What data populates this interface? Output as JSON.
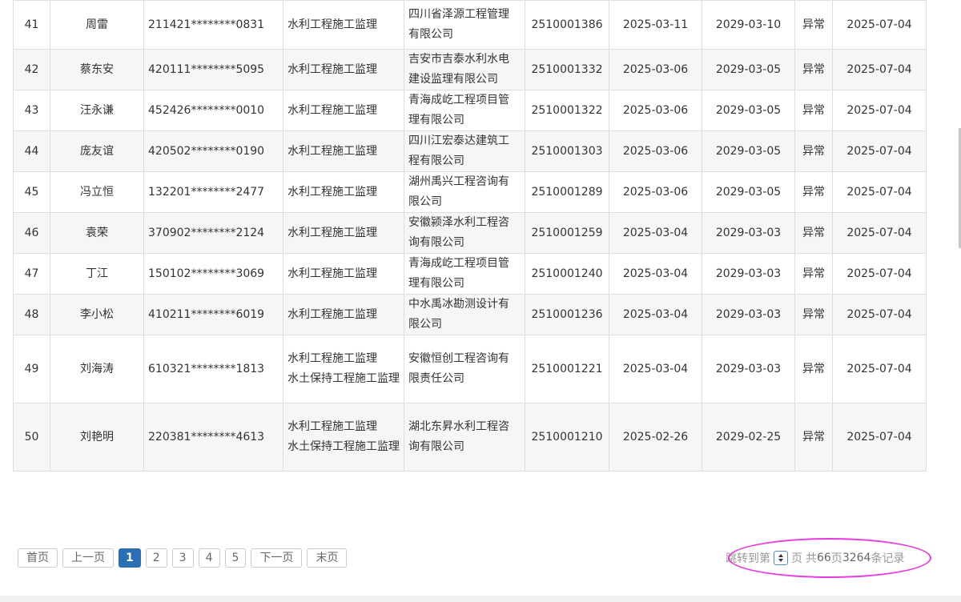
{
  "table": {
    "rows": [
      {
        "no": "41",
        "name": "周雷",
        "id": "211421********0831",
        "major": "水利工程施工监理",
        "company": "四川省泽源工程管理有限公司",
        "cert": "2510001386",
        "reg": "2025-03-11",
        "expire": "2029-03-10",
        "status": "异常",
        "updated": "2025-07-04"
      },
      {
        "no": "42",
        "name": "蔡东安",
        "id": "420111********5095",
        "major": "水利工程施工监理",
        "company": "吉安市吉泰水利水电建设监理有限公司",
        "cert": "2510001332",
        "reg": "2025-03-06",
        "expire": "2029-03-05",
        "status": "异常",
        "updated": "2025-07-04"
      },
      {
        "no": "43",
        "name": "汪永谦",
        "id": "452426********0010",
        "major": "水利工程施工监理",
        "company": "青海成屹工程项目管理有限公司",
        "cert": "2510001322",
        "reg": "2025-03-06",
        "expire": "2029-03-05",
        "status": "异常",
        "updated": "2025-07-04"
      },
      {
        "no": "44",
        "name": "庞友谊",
        "id": "420502********0190",
        "major": "水利工程施工监理",
        "company": "四川江宏泰达建筑工程有限公司",
        "cert": "2510001303",
        "reg": "2025-03-06",
        "expire": "2029-03-05",
        "status": "异常",
        "updated": "2025-07-04"
      },
      {
        "no": "45",
        "name": "冯立恒",
        "id": "132201********2477",
        "major": "水利工程施工监理",
        "company": "湖州禹兴工程咨询有限公司",
        "cert": "2510001289",
        "reg": "2025-03-06",
        "expire": "2029-03-05",
        "status": "异常",
        "updated": "2025-07-04"
      },
      {
        "no": "46",
        "name": "袁荣",
        "id": "370902********2124",
        "major": "水利工程施工监理",
        "company": "安徽颍泽水利工程咨询有限公司",
        "cert": "2510001259",
        "reg": "2025-03-04",
        "expire": "2029-03-03",
        "status": "异常",
        "updated": "2025-07-04"
      },
      {
        "no": "47",
        "name": "丁江",
        "id": "150102********3069",
        "major": "水利工程施工监理",
        "company": "青海成屹工程项目管理有限公司",
        "cert": "2510001240",
        "reg": "2025-03-04",
        "expire": "2029-03-03",
        "status": "异常",
        "updated": "2025-07-04"
      },
      {
        "no": "48",
        "name": "李小松",
        "id": "410211********6019",
        "major": "水利工程施工监理",
        "company": "中水禹冰勘测设计有限公司",
        "cert": "2510001236",
        "reg": "2025-03-04",
        "expire": "2029-03-03",
        "status": "异常",
        "updated": "2025-07-04"
      },
      {
        "no": "49",
        "name": "刘海涛",
        "id": "610321********1813",
        "major": "水利工程施工监理\n水土保持工程施工监理",
        "company": "安徽恒创工程咨询有限责任公司",
        "cert": "2510001221",
        "reg": "2025-03-04",
        "expire": "2029-03-03",
        "status": "异常",
        "updated": "2025-07-04"
      },
      {
        "no": "50",
        "name": "刘艳明",
        "id": "220381********4613",
        "major": "水利工程施工监理\n水土保持工程施工监理",
        "company": "湖北东昇水利工程咨询有限公司",
        "cert": "2510001210",
        "reg": "2025-02-26",
        "expire": "2029-02-25",
        "status": "异常",
        "updated": "2025-07-04"
      }
    ]
  },
  "pagination": {
    "first": "首页",
    "prev": "上一页",
    "pages": [
      "1",
      "2",
      "3",
      "4",
      "5"
    ],
    "active_page": "1",
    "next": "下一页",
    "last": "末页",
    "jump_prefix": "跳转到第",
    "jump_suffix": "页",
    "total_prefix": "共",
    "total_pages": "66",
    "total_pages_unit": "页",
    "total_records": "3264",
    "total_records_unit": "条记录"
  },
  "colors": {
    "active_page": "#2a6fb3",
    "annotation": "#e83be0",
    "row_stripe": "#f6f6f6"
  }
}
